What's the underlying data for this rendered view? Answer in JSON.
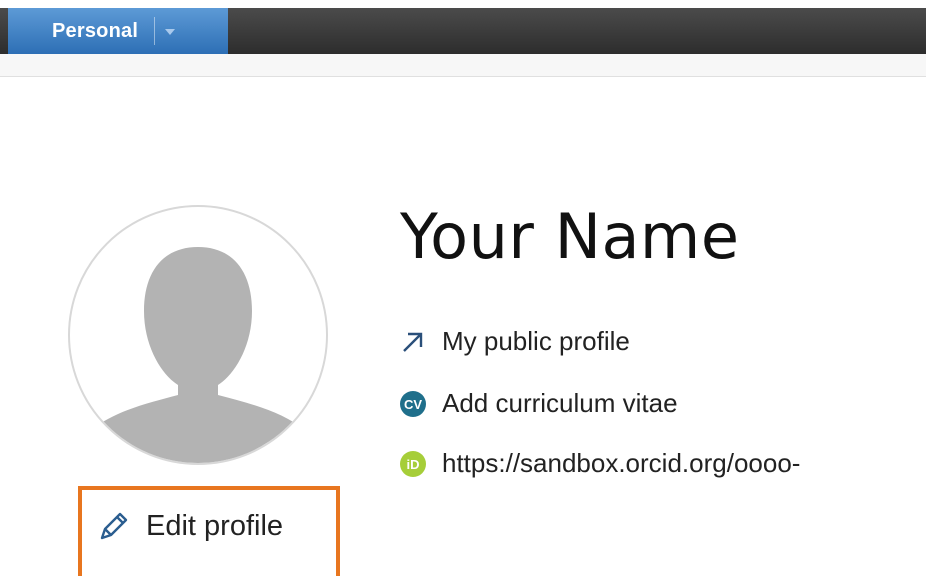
{
  "nav": {
    "active_tab": "Personal"
  },
  "profile": {
    "name": "Your Name",
    "links": [
      {
        "label": "My public profile",
        "icon": "external-arrow-icon"
      },
      {
        "label": "Add curriculum vitae",
        "icon": "cv-icon"
      },
      {
        "label": "https://sandbox.orcid.org/oooo-",
        "icon": "orcid-icon"
      }
    ],
    "edit_label": "Edit profile"
  },
  "colors": {
    "tab_blue": "#3a7fc4",
    "highlight_orange": "#e8761f",
    "cv_teal": "#1f6f8b",
    "orcid_green": "#a6ce39"
  }
}
